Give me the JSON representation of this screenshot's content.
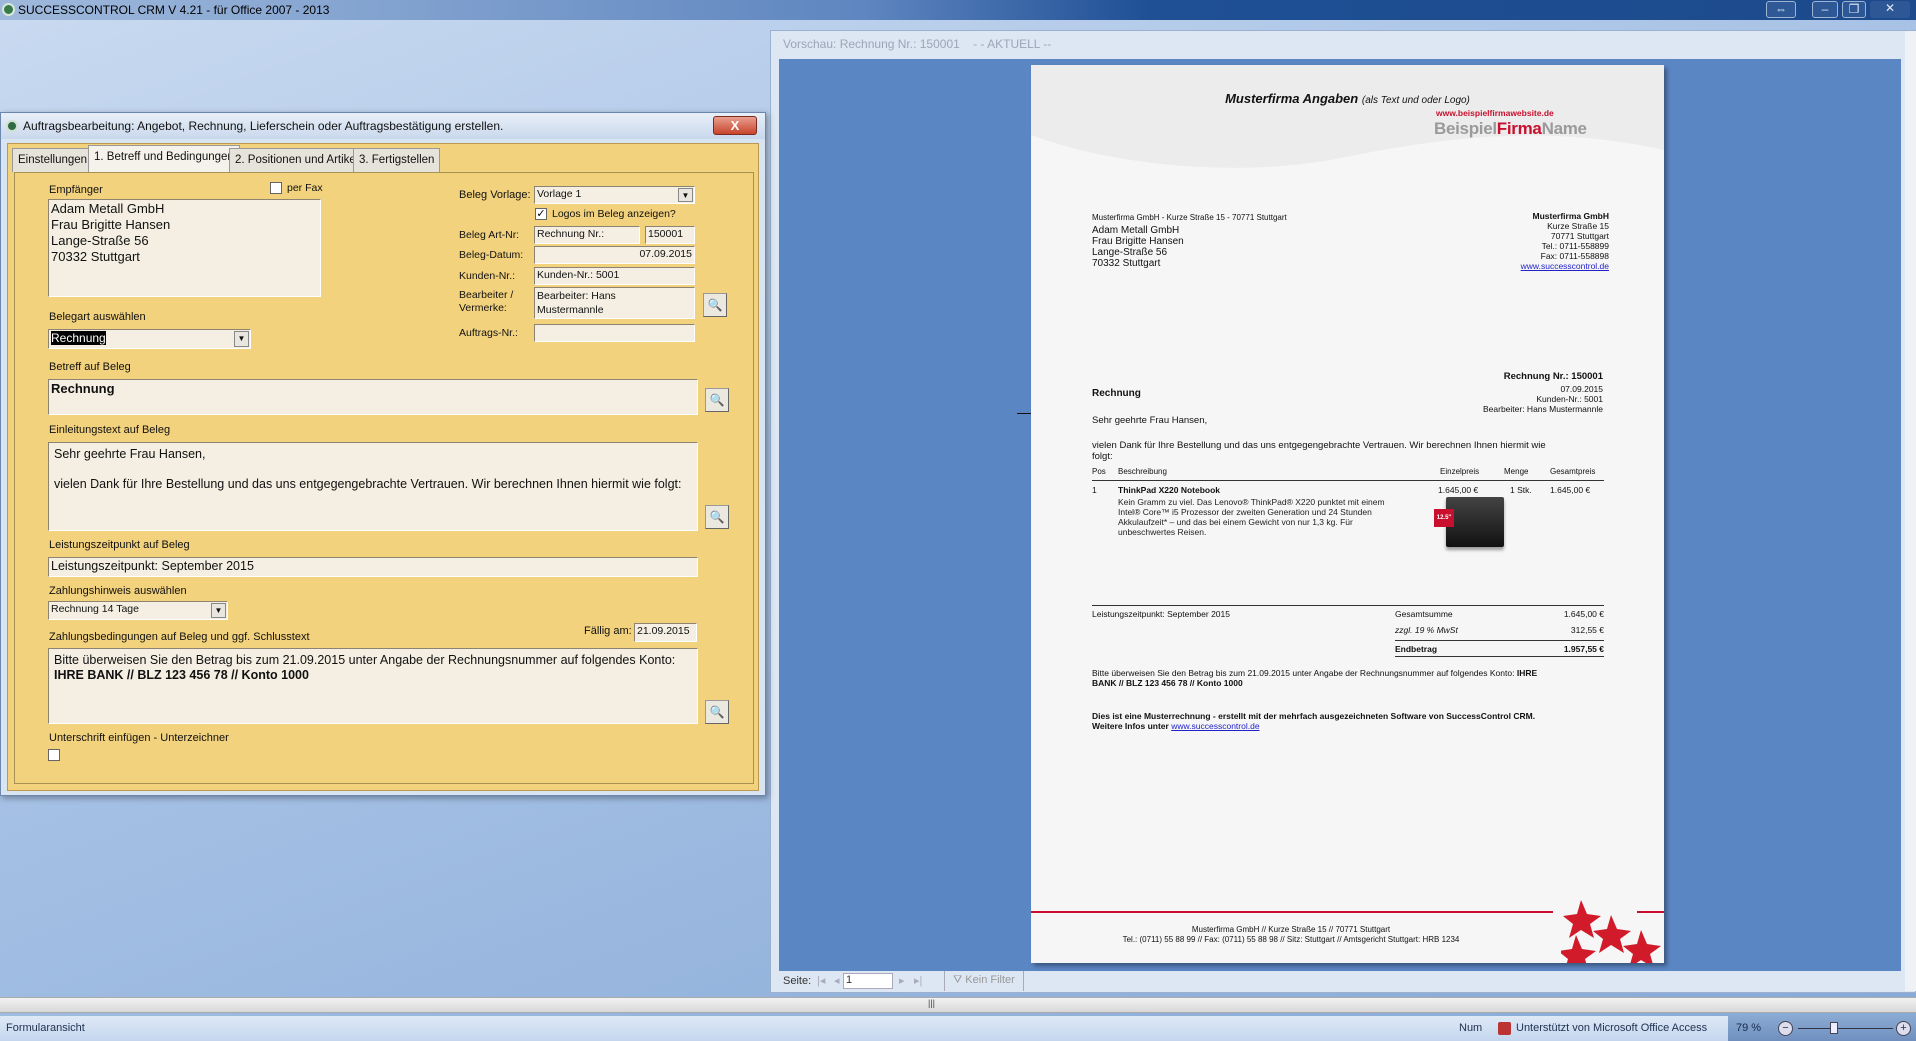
{
  "app": {
    "title": "SUCCESSCONTROL CRM V 4.21 - für Office 2007 - 2013"
  },
  "dialog": {
    "title": "Auftragsbearbeitung: Angebot, Rechnung, Lieferschein oder Auftragsbestätigung erstellen.",
    "close_label": "X",
    "tabs": [
      {
        "label": "Einstellungen"
      },
      {
        "label": "1. Betreff und Bedingungen"
      },
      {
        "label": "2. Positionen und Artikel"
      },
      {
        "label": "3. Fertigstellen"
      }
    ],
    "active_tab": 1,
    "empfaenger_label": "Empfänger",
    "per_fax_label": "per Fax",
    "per_fax_checked": false,
    "empfaenger_value": "Adam Metall GmbH\nFrau Brigitte Hansen\nLange-Straße 56\n70332 Stuttgart",
    "beleg_vorlage_label": "Beleg Vorlage:",
    "beleg_vorlage_value": "Vorlage 1",
    "logos_label": "Logos im Beleg anzeigen?",
    "logos_checked": true,
    "beleg_art_label": "Beleg Art-Nr:",
    "beleg_art_value": "Rechnung Nr.:",
    "beleg_nr_value": "150001",
    "beleg_datum_label": "Beleg-Datum:",
    "beleg_datum_value": "07.09.2015",
    "kunden_label": "Kunden-Nr.:",
    "kunden_value": "Kunden-Nr.: 5001",
    "bearbeiter_label": "Bearbeiter /\nVermerke:",
    "bearbeiter_value": "Bearbeiter: Hans\nMustermannle",
    "auftrags_label": "Auftrags-Nr.:",
    "auftrags_value": "",
    "belegart_label": "Belegart auswählen",
    "belegart_value": "Rechnung",
    "betreff_label": "Betreff auf Beleg",
    "betreff_value": "Rechnung",
    "einleitung_label": "Einleitungstext auf Beleg",
    "einleitung_value": "Sehr geehrte Frau Hansen,\n\nvielen Dank für Ihre Bestellung und das uns entgegengebrachte Vertrauen. Wir berechnen Ihnen hiermit wie folgt:",
    "leistung_label": "Leistungszeitpunkt auf Beleg",
    "leistung_value": "Leistungszeitpunkt: September 2015",
    "zahlungshinweis_label": "Zahlungshinweis auswählen",
    "zahlungshinweis_value": "Rechnung 14 Tage",
    "zahlungsbed_label": "Zahlungsbedingungen auf Beleg und ggf. Schlusstext",
    "faellig_label": "Fällig am:",
    "faellig_value": "21.09.2015",
    "zahlungsbed_value_plain": "Bitte überweisen Sie den Betrag bis zum 21.09.2015 unter Angabe der Rechnungsnummer auf folgendes Konto: ",
    "zahlungsbed_value_bold": "IHRE BANK // BLZ 123 456 78 // Konto 1000",
    "unterschrift_label": "Unterschrift einfügen - Unterzeichner",
    "unterschrift_checked": false
  },
  "preview": {
    "title": "Vorschau: Rechnung Nr.: 150001    - - AKTUELL --",
    "doc": {
      "header_bold": "Musterfirma Angaben",
      "header_italic": "(als Text und oder Logo)",
      "logo_url_text": "www.beispielfirmawebsite.de",
      "logo_name_1": "Beispiel",
      "logo_name_2": "Firma",
      "logo_name_3": "Name",
      "sender_line": "Musterfirma GmbH - Kurze Straße 15 - 70771 Stuttgart",
      "recipient": [
        "Adam Metall GmbH",
        "Frau Brigitte Hansen",
        "Lange-Straße 56",
        "70332 Stuttgart"
      ],
      "company": [
        "Musterfirma GmbH",
        "Kurze Straße 15",
        "70771 Stuttgart",
        "Tel.: 0711-558899",
        "Fax: 0711-558898"
      ],
      "company_link": "www.successcontrol.de",
      "invoice_no": "Rechnung Nr.: 150001",
      "invoice_meta": [
        "07.09.2015",
        "Kunden-Nr.: 5001",
        "Bearbeiter: Hans Mustermannle"
      ],
      "subject": "Rechnung",
      "greeting": "Sehr geehrte Frau Hansen,",
      "intro": "vielen Dank für Ihre Bestellung und das uns entgegengebrachte Vertrauen. Wir berechnen Ihnen hiermit wie",
      "intro2": "folgt:",
      "table_headers": [
        "Pos",
        "Beschreibung",
        "Einzelpreis",
        "Menge",
        "Gesamtpreis"
      ],
      "items": [
        {
          "pos": "1",
          "name": "ThinkPad X220 Notebook",
          "desc": [
            "Kein Gramm zu viel. Das Lenovo® ThinkPad® X220 punktet mit einem",
            "Intel® Core™ i5 Prozessor der zweiten Generation und 24 Stunden",
            "Akkulaufzeit* – und das bei einem Gewicht von nur 1,3 kg. Für",
            "unbeschwertes Reisen."
          ],
          "price": "1.645,00 €",
          "qty": "1 Stk.",
          "total": "1.645,00 €",
          "badge": "12.5\""
        }
      ],
      "leistung": "Leistungszeitpunkt: September 2015",
      "totals": [
        {
          "label": "Gesamtsumme",
          "value": "1.645,00 €"
        },
        {
          "label": "zzgl. 19 % MwSt",
          "value": "312,55 €"
        },
        {
          "label": "Endbetrag",
          "value": "1.957,55 €"
        }
      ],
      "payment_plain": "Bitte überweisen Sie den Betrag bis zum 21.09.2015 unter Angabe der Rechnungsnummer auf folgendes Konto:",
      "payment_bold1": "IHRE",
      "payment_bold2": "BANK // BLZ 123 456 78 // Konto 1000",
      "promo1": "Dies ist eine Musterrechnung - erstellt mit der mehrfach ausgezeichneten Software von SuccessControl CRM.",
      "promo2": "Weitere Infos unter",
      "promo_link": "www.successcontrol.de",
      "footer1": "Musterfirma GmbH // Kurze Straße 15 // 70771 Stuttgart",
      "footer2": "Tel.: (0711) 55 88 99 // Fax: (0711) 55 88 98 // Sitz: Stuttgart // Amtsgericht Stuttgart: HRB 1234"
    },
    "nav": {
      "page_label": "Seite:",
      "page_value": "1",
      "filter_label": "Kein Filter"
    }
  },
  "statusbar": {
    "left": "Formularansicht",
    "num": "Num",
    "powered": "Unterstützt von Microsoft Office Access",
    "zoom": "79 %",
    "zoom_percent": 79
  },
  "colors": {
    "dialog_bg": "#f3d27d",
    "preview_bg": "#5b86c4",
    "brand_red": "#c8102e",
    "title_blue": "#1f4f95"
  }
}
